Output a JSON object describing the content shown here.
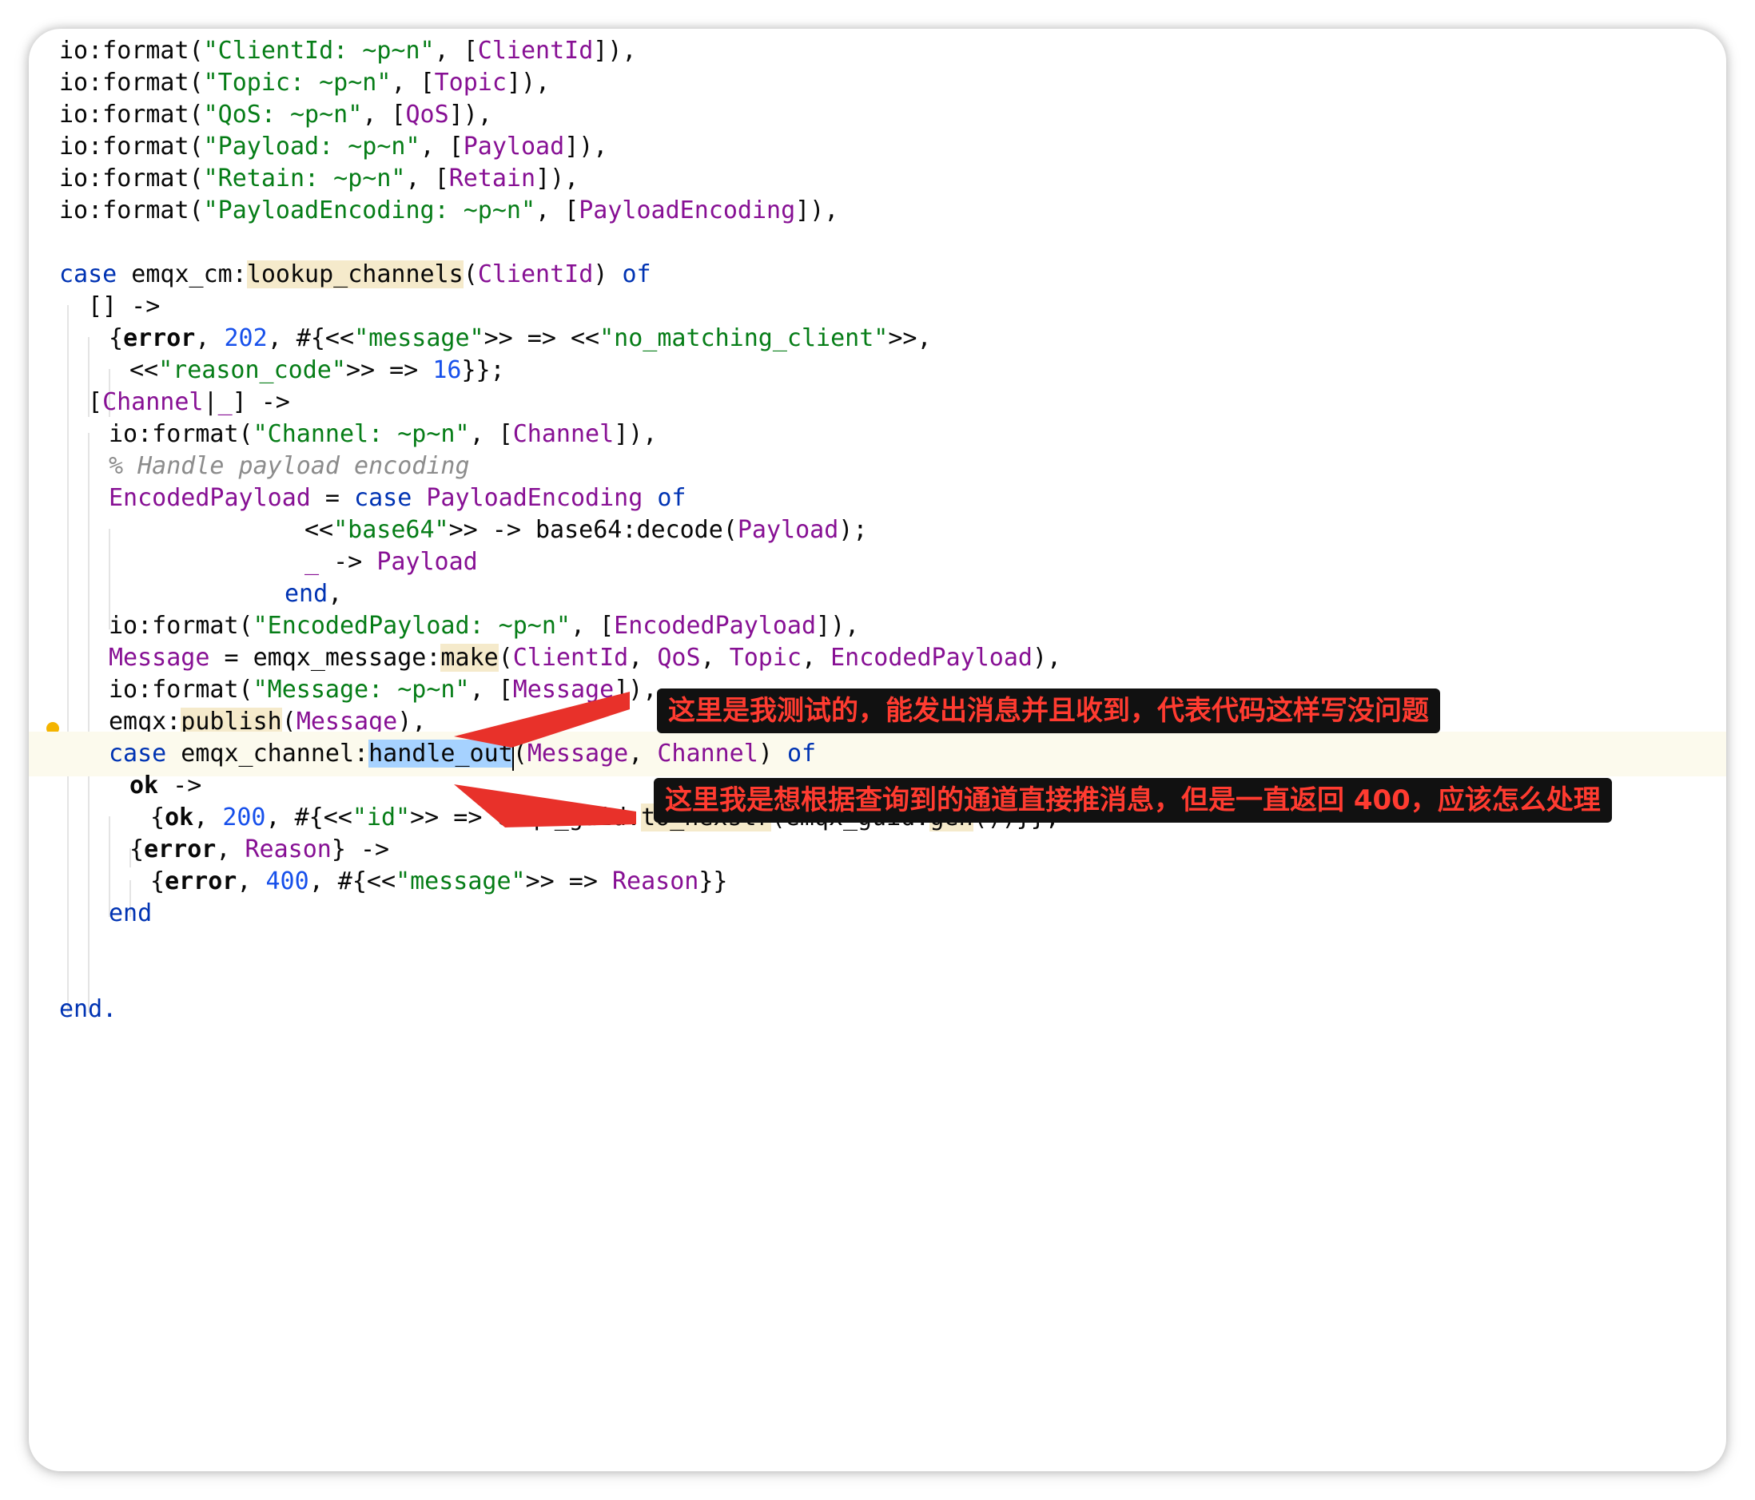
{
  "code": {
    "l1": [
      "io:format(",
      "\"ClientId: ~p~n\"",
      ", [",
      "ClientId",
      "]),"
    ],
    "l2": [
      "io:format(",
      "\"Topic: ~p~n\"",
      ", [",
      "Topic",
      "]),"
    ],
    "l3": [
      "io:format(",
      "\"QoS: ~p~n\"",
      ", [",
      "QoS",
      "]),"
    ],
    "l4": [
      "io:format(",
      "\"Payload: ~p~n\"",
      ", [",
      "Payload",
      "]),"
    ],
    "l5": [
      "io:format(",
      "\"Retain: ~p~n\"",
      ", [",
      "Retain",
      "]),"
    ],
    "l6": [
      "io:format(",
      "\"PayloadEncoding: ~p~n\"",
      ", [",
      "PayloadEncoding",
      "]),"
    ],
    "l8": [
      "case",
      " emqx_cm:",
      "lookup_channels",
      "(",
      "ClientId",
      ") ",
      "of"
    ],
    "l9": [
      "[] ->"
    ],
    "l10": [
      "{",
      "error",
      ", ",
      "202",
      ", #{<<",
      "\"message\"",
      ">> => <<",
      "\"no_matching_client\"",
      ">>,"
    ],
    "l11": [
      "<<",
      "\"reason_code\"",
      ">> => ",
      "16",
      "}};"
    ],
    "l12": [
      "[",
      "Channel",
      "|",
      "_",
      "] ->"
    ],
    "l13": [
      "io:format(",
      "\"Channel: ~p~n\"",
      ", [",
      "Channel",
      "]),"
    ],
    "l14": [
      "% Handle payload encoding"
    ],
    "l15": [
      "EncodedPayload",
      " = ",
      "case",
      " ",
      "PayloadEncoding",
      " ",
      "of"
    ],
    "l16": [
      "<<",
      "\"base64\"",
      ">> -> base64:decode(",
      "Payload",
      ");"
    ],
    "l17": [
      "_",
      " -> ",
      "Payload"
    ],
    "l18": [
      "end",
      ","
    ],
    "l19": [
      "io:format(",
      "\"EncodedPayload: ~p~n\"",
      ", [",
      "EncodedPayload",
      "]),"
    ],
    "l20": [
      "Message",
      " = emqx_message:",
      "make",
      "(",
      "ClientId",
      ", ",
      "QoS",
      ", ",
      "Topic",
      ", ",
      "EncodedPayload",
      "),"
    ],
    "l21": [
      "io:format(",
      "\"Message: ~p~n\"",
      ", [",
      "Message",
      "]),"
    ],
    "l22": [
      "emqx:",
      "publish",
      "(",
      "Message",
      "),"
    ],
    "l23": [
      "case",
      " emqx_channel:",
      "handle_out",
      "(",
      "Message",
      ", ",
      "Channel",
      ") ",
      "of"
    ],
    "l24": [
      "ok",
      " ->"
    ],
    "l25": [
      "{",
      "ok",
      ", ",
      "200",
      ", #{<<",
      "\"id\"",
      ">> => emqx_guid:",
      "to_hexstr",
      "(emqx_guid:",
      "gen",
      "())}};"
    ],
    "l26": [
      "{",
      "error",
      ", ",
      "Reason",
      "} ->"
    ],
    "l27": [
      "{",
      "error",
      ", ",
      "400",
      ", #{<<",
      "\"message\"",
      ">> => ",
      "Reason",
      "}}"
    ],
    "l28": [
      "end"
    ],
    "l31": [
      "end."
    ]
  },
  "annotations": {
    "first": "这里是我测试的，能发出消息并且收到，代表代码这样写没问题",
    "second": "这里我是想根据查询到的通道直接推消息，但是一直返回 400，应该怎么处理"
  },
  "icons": {
    "gutter": "lightbulb-icon"
  },
  "colors": {
    "annotation_text": "#ff3b30",
    "annotation_bg": "#111111",
    "arrow": "#e8312a"
  }
}
